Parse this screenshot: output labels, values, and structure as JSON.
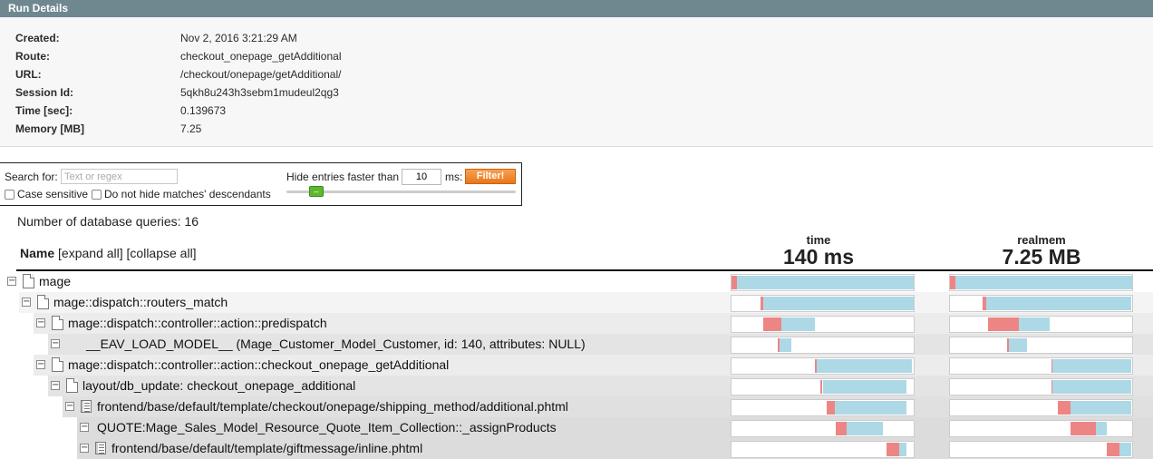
{
  "title": "Run Details",
  "details": [
    {
      "label": "Created:",
      "value": "Nov 2, 2016 3:21:29 AM"
    },
    {
      "label": "Route:",
      "value": "checkout_onepage_getAdditional"
    },
    {
      "label": "URL:",
      "value": "/checkout/onepage/getAdditional/"
    },
    {
      "label": "Session Id:",
      "value": "5qkh8u243h3sebm1mudeul2qg3"
    },
    {
      "label": "Time [sec]:",
      "value": "0.139673"
    },
    {
      "label": "Memory [MB]",
      "value": "7.25"
    }
  ],
  "filter": {
    "search_label": "Search for:",
    "search_placeholder": "Text or regex",
    "case_sensitive": "Case sensitive",
    "no_hide_desc": "Do not hide matches' descendants",
    "hide_label": "Hide entries faster than",
    "ms_value": "10",
    "ms_label": "ms:",
    "filter_button": "Filter!"
  },
  "db_queries": "Number of database queries: 16",
  "header": {
    "name": "Name",
    "expand_all": "[expand all]",
    "collapse_all": "[collapse all]"
  },
  "columns": [
    {
      "sub": "time",
      "value": "140 ms"
    },
    {
      "sub": "realmem",
      "value": "7.25 MB"
    }
  ],
  "colors": {
    "self": "#ee8585",
    "children": "#add8e6"
  },
  "rows": [
    {
      "label": "mage",
      "icon": "file",
      "depth": 0,
      "time": [
        0.0,
        0.03,
        1.0
      ],
      "mem": [
        0.0,
        0.03,
        1.0
      ]
    },
    {
      "label": "mage::dispatch::routers_match",
      "icon": "file",
      "depth": 1,
      "time": [
        0.16,
        0.175,
        1.0
      ],
      "mem": [
        0.18,
        0.2,
        0.995
      ]
    },
    {
      "label": "mage::dispatch::controller::action::predispatch",
      "icon": "file",
      "depth": 2,
      "time": [
        0.175,
        0.275,
        0.46
      ],
      "mem": [
        0.21,
        0.38,
        0.55
      ]
    },
    {
      "label": "__EAV_LOAD_MODEL__ (Mage_Customer_Model_Customer, id: 140, attributes: NULL)",
      "icon": "none",
      "depth": 3,
      "time": [
        0.255,
        0.265,
        0.33
      ],
      "mem": [
        0.315,
        0.325,
        0.425
      ]
    },
    {
      "label": "mage::dispatch::controller::action::checkout_onepage_getAdditional",
      "icon": "file",
      "depth": 2,
      "time": [
        0.46,
        0.47,
        0.99
      ],
      "mem": [
        0.555,
        0.56,
        0.995
      ]
    },
    {
      "label": "layout/db_update: checkout_onepage_additional",
      "icon": "file",
      "depth": 3,
      "time": [
        0.49,
        0.5,
        0.96
      ],
      "mem": [
        0.555,
        0.56,
        0.995
      ]
    },
    {
      "label": "frontend/base/default/template/checkout/onepage/shipping_method/additional.phtml",
      "icon": "template",
      "depth": 4,
      "time": [
        0.52,
        0.565,
        0.96
      ],
      "mem": [
        0.59,
        0.66,
        0.995
      ]
    },
    {
      "label": "QUOTE:Mage_Sales_Model_Resource_Quote_Item_Collection::_assignProducts",
      "icon": "none",
      "depth": 5,
      "time": [
        0.57,
        0.63,
        0.83
      ],
      "mem": [
        0.66,
        0.8,
        0.86
      ]
    },
    {
      "label": "frontend/base/default/template/giftmessage/inline.phtml",
      "icon": "template",
      "depth": 5,
      "time": [
        0.85,
        0.92,
        0.96
      ],
      "mem": [
        0.86,
        0.93,
        0.995
      ]
    }
  ]
}
